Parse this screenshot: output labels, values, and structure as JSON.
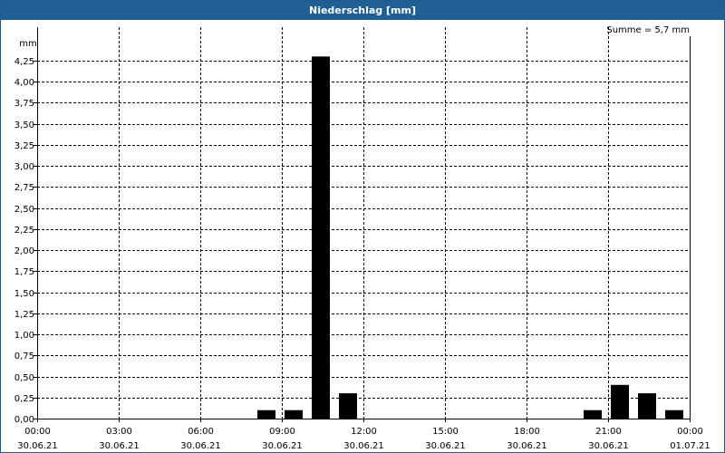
{
  "window": {
    "title": "Niederschlag [mm]"
  },
  "chart_data": {
    "type": "bar",
    "ylabel": "mm",
    "annotation": "Summe = 5,7 mm",
    "ylim": [
      0,
      4.5
    ],
    "y_ticks": [
      0,
      0.25,
      0.5,
      0.75,
      1.0,
      1.25,
      1.5,
      1.75,
      2.0,
      2.25,
      2.5,
      2.75,
      3.0,
      3.25,
      3.5,
      3.75,
      4.0,
      4.25
    ],
    "y_tick_labels": [
      "0,00",
      "0,25",
      "0,50",
      "0,75",
      "1,00",
      "1,25",
      "1,50",
      "1,75",
      "2,00",
      "2,25",
      "2,50",
      "2,75",
      "3,00",
      "3,25",
      "3,50",
      "3,75",
      "4,00",
      "4,25"
    ],
    "xlim": [
      "30.06.21 00:00",
      "01.07.21 00:00"
    ],
    "x_ticks": [
      {
        "time": "00:00",
        "date": "30.06.21"
      },
      {
        "time": "03:00",
        "date": "30.06.21"
      },
      {
        "time": "06:00",
        "date": "30.06.21"
      },
      {
        "time": "09:00",
        "date": "30.06.21"
      },
      {
        "time": "12:00",
        "date": "30.06.21"
      },
      {
        "time": "15:00",
        "date": "30.06.21"
      },
      {
        "time": "18:00",
        "date": "30.06.21"
      },
      {
        "time": "21:00",
        "date": "30.06.21"
      },
      {
        "time": "00:00",
        "date": "01.07.21"
      }
    ],
    "bar_interval": "1 h",
    "bars": [
      {
        "start": "30.06.21 08:00",
        "value": 0.1
      },
      {
        "start": "30.06.21 09:00",
        "value": 0.1
      },
      {
        "start": "30.06.21 10:00",
        "value": 4.3
      },
      {
        "start": "30.06.21 11:00",
        "value": 0.3
      },
      {
        "start": "30.06.21 20:00",
        "value": 0.1
      },
      {
        "start": "30.06.21 21:00",
        "value": 0.4
      },
      {
        "start": "30.06.21 22:00",
        "value": 0.3
      },
      {
        "start": "30.06.21 23:00",
        "value": 0.1
      }
    ],
    "grid": true,
    "colors": {
      "bar": "#000000",
      "grid": "#000000",
      "title_bg": "#1f5f94"
    }
  }
}
